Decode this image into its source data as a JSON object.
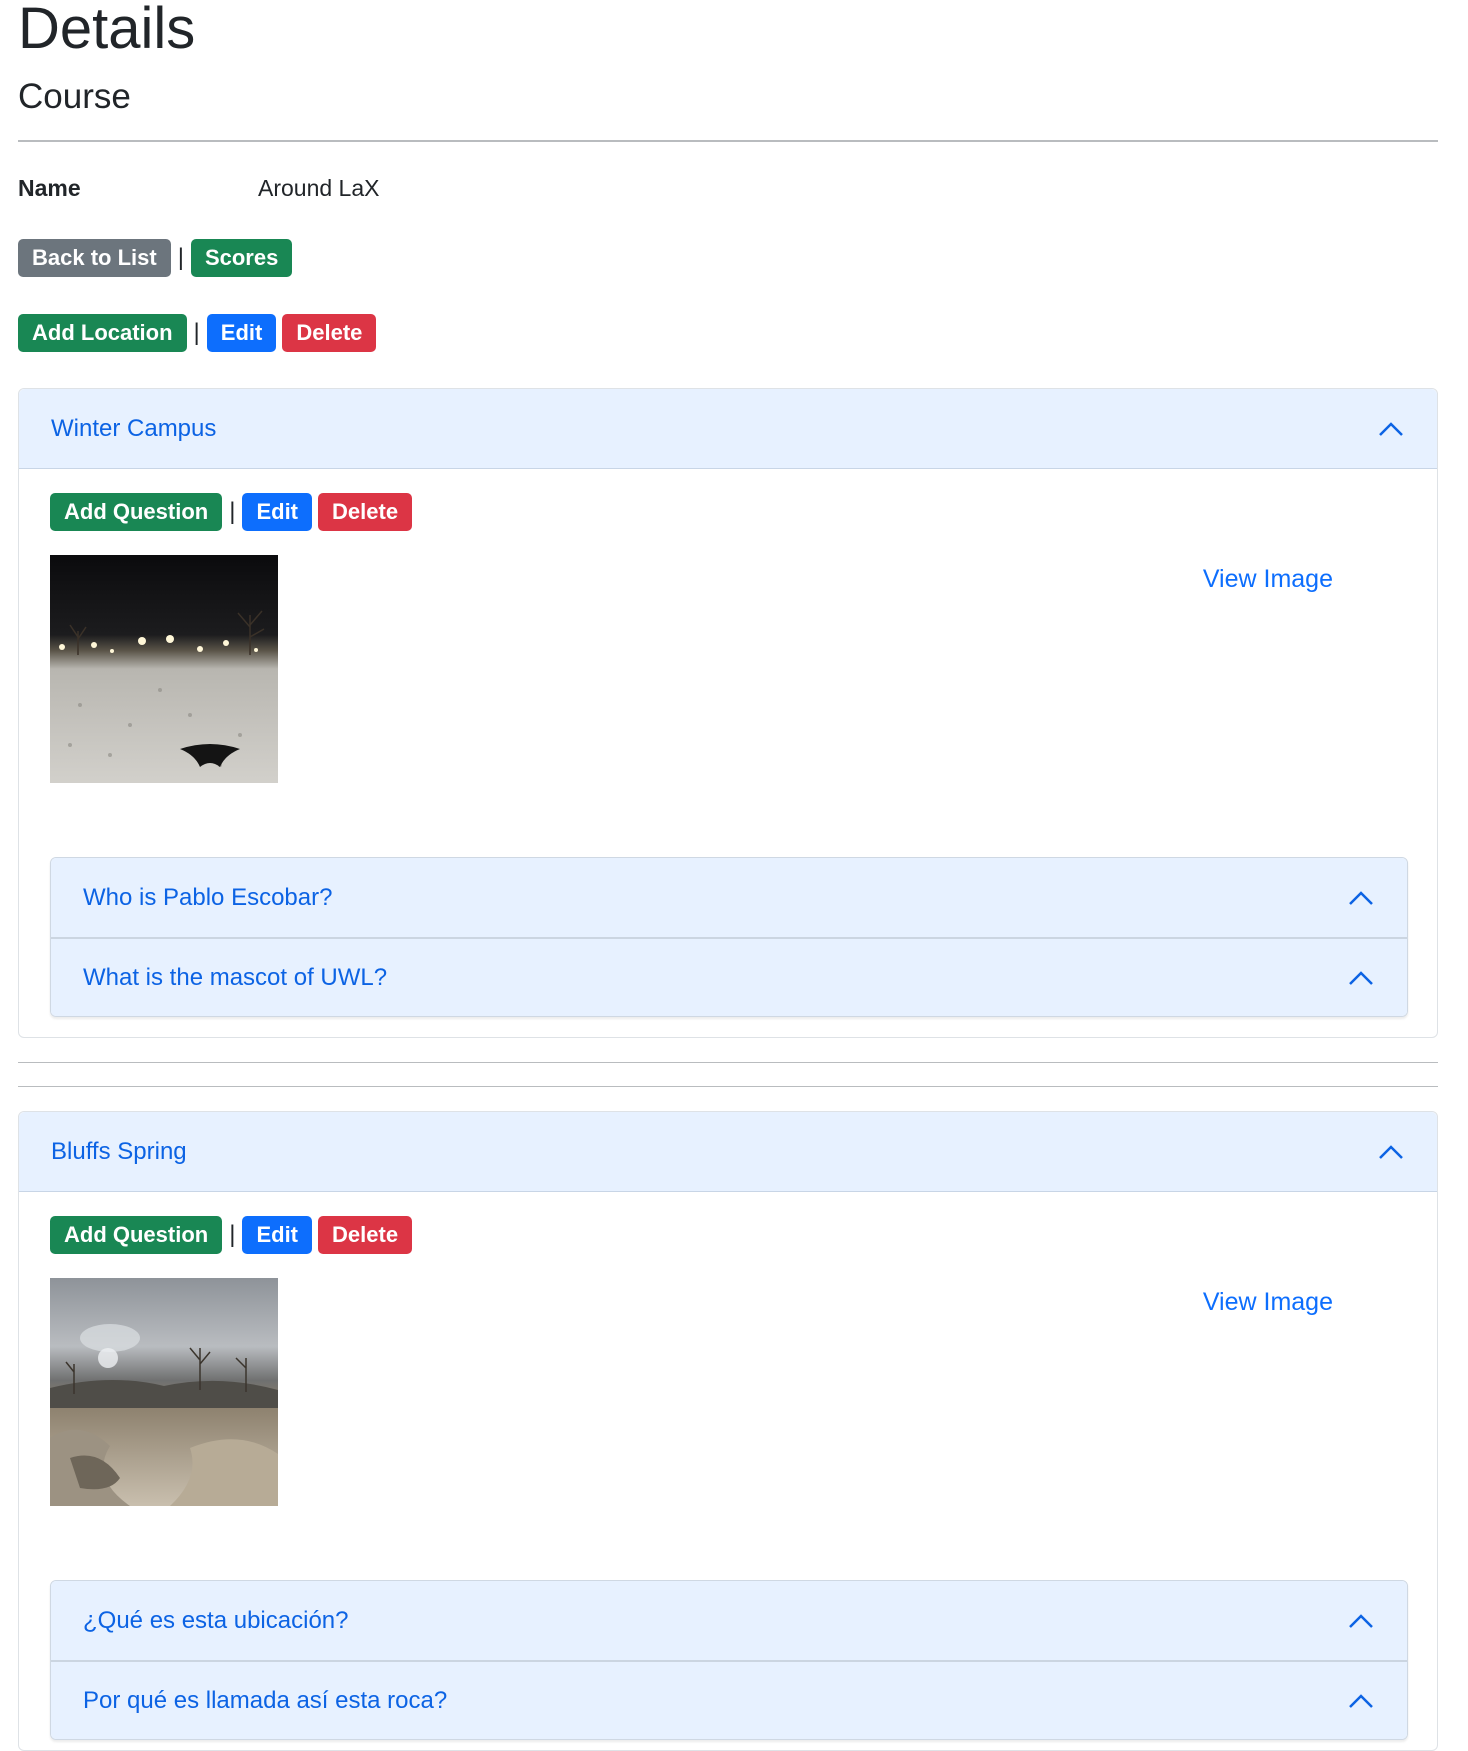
{
  "page": {
    "title": "Details",
    "subtitle": "Course"
  },
  "course": {
    "name_label": "Name",
    "name_value": "Around LaX"
  },
  "nav": {
    "back_label": "Back to List",
    "scores_label": "Scores",
    "separator": "|"
  },
  "course_actions": {
    "add_location_label": "Add Location",
    "edit_label": "Edit",
    "delete_label": "Delete"
  },
  "locations": [
    {
      "name": "Winter Campus",
      "add_question_label": "Add Question",
      "edit_label": "Edit",
      "delete_label": "Delete",
      "view_image_label": "View Image",
      "questions": [
        "Who is Pablo Escobar?",
        "What is the mascot of UWL?"
      ]
    },
    {
      "name": "Bluffs Spring",
      "add_question_label": "Add Question",
      "edit_label": "Edit",
      "delete_label": "Delete",
      "view_image_label": "View Image",
      "questions": [
        "¿Qué es esta ubicación?",
        "Por qué es llamada así esta roca?"
      ]
    }
  ],
  "colors": {
    "secondary": "#6c757d",
    "success": "#198754",
    "primary": "#0d6efd",
    "danger": "#dc3545",
    "accordion_bg": "#e7f1ff",
    "accordion_text": "#0c63e4"
  },
  "icons": {
    "accordion_toggle": "chevron-up-icon"
  }
}
